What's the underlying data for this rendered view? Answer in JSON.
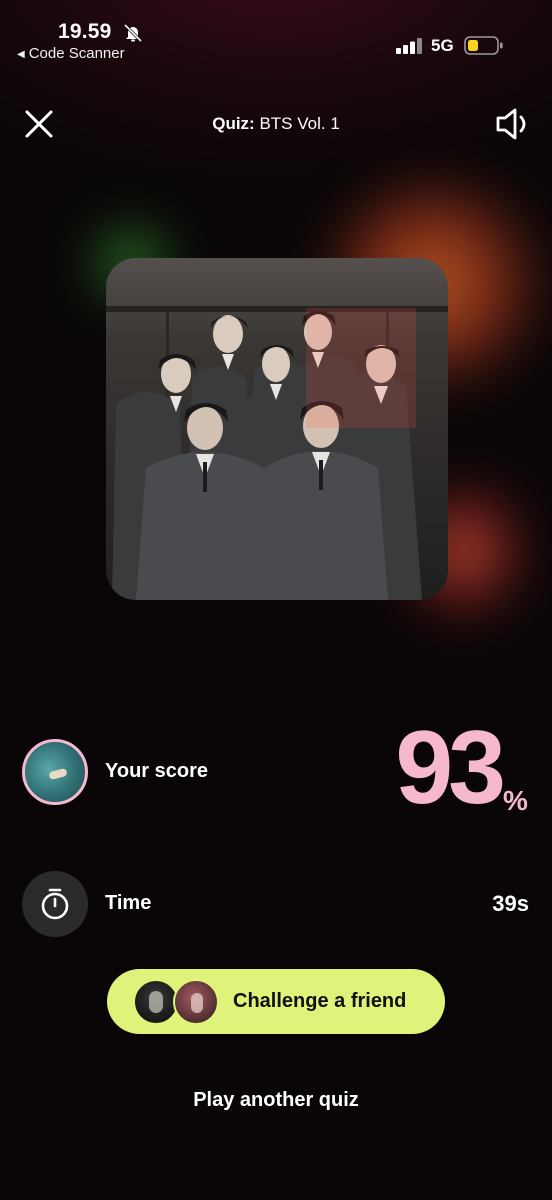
{
  "status_bar": {
    "time": "19.59",
    "back_app": "Code Scanner",
    "network": "5G",
    "icons": [
      "bell-slash-icon",
      "signal-icon",
      "battery-icon"
    ]
  },
  "header": {
    "title_prefix": "Quiz:",
    "title": "BTS Vol. 1",
    "icons": [
      "close-icon",
      "speaker-icon"
    ]
  },
  "result": {
    "score_label": "Your score",
    "score_value": "93",
    "score_unit": "%",
    "time_label": "Time",
    "time_value": "39s",
    "icons": [
      "stopwatch-icon"
    ]
  },
  "actions": {
    "challenge_label": "Challenge a friend",
    "play_another_label": "Play another quiz"
  },
  "colors": {
    "background": "#0a0607",
    "score_pink": "#f6b8cc",
    "button_lime": "#dff279"
  }
}
